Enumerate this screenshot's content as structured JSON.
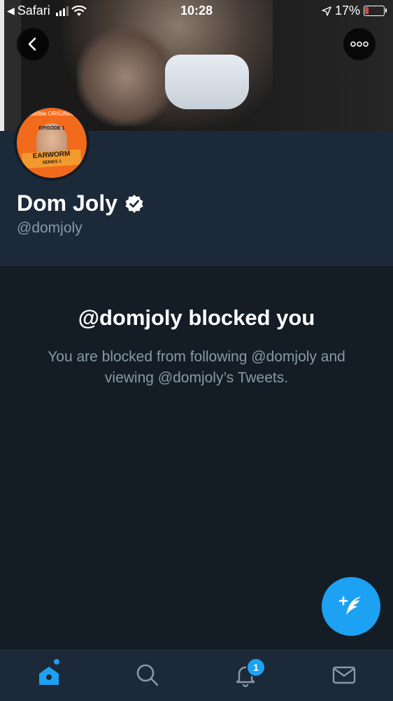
{
  "status_bar": {
    "back_app": "Safari",
    "time": "10:28",
    "battery_percent": "17%"
  },
  "profile": {
    "display_name": "Dom Joly",
    "handle": "@domjoly",
    "verified": true,
    "avatar_text": {
      "brand": "audible ORIGINAL",
      "episode": "EPISODE 1",
      "title": "EARWORM",
      "subtitle": "SERIES 1"
    }
  },
  "blocked": {
    "title": "@domjoly blocked you",
    "message": "You are blocked from following @domjoly and viewing @domjoly’s Tweets."
  },
  "tab_bar": {
    "notifications_badge": "1"
  },
  "icons": {
    "back": "chevron-left-icon",
    "more": "more-icon",
    "verified": "verified-badge-icon",
    "compose": "compose-tweet-icon",
    "home": "home-icon",
    "search": "search-icon",
    "notifications": "bell-icon",
    "messages": "mail-icon"
  },
  "colors": {
    "accent": "#1da1f2",
    "background": "#141d26",
    "surface": "#1c2938",
    "secondary_text": "#8899a6"
  }
}
